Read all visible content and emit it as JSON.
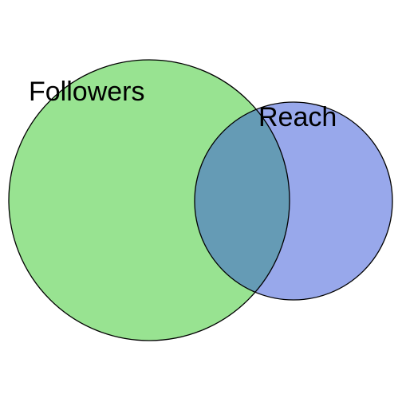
{
  "venn": {
    "sets": [
      {
        "label": "Followers",
        "color": "#98E391"
      },
      {
        "label": "Reach",
        "color": "#98A8EB"
      }
    ],
    "intersection_color": "#659BB5",
    "stroke_color": "#000000"
  }
}
